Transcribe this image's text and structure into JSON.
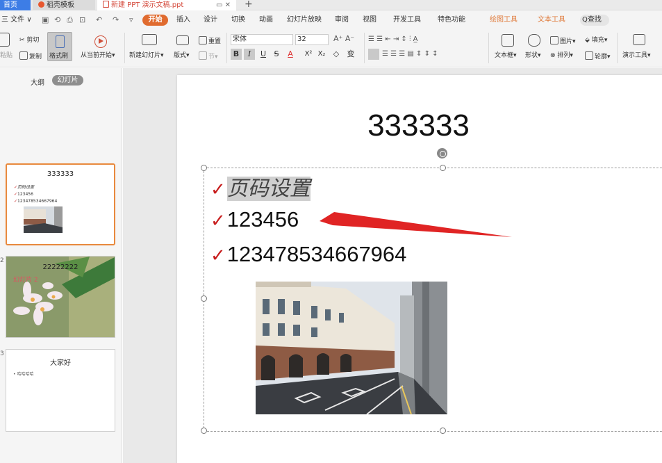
{
  "tabs": {
    "home": "首页",
    "template": "稻壳模板",
    "document": "新建 PPT 演示文稿.ppt",
    "add": "+"
  },
  "menu": {
    "file": "三 文件 ∨",
    "tabs": [
      "开始",
      "插入",
      "设计",
      "切换",
      "动画",
      "幻灯片放映",
      "审阅",
      "视图",
      "开发工具",
      "特色功能",
      "绘图工具",
      "文本工具"
    ],
    "search": "Q查找"
  },
  "ribbon": {
    "paste": "粘贴",
    "cut": "剪切",
    "copy": "复制",
    "format_painter": "格式刷",
    "play_from_current": "从当前开始",
    "new_slide": "新建幻灯片",
    "layout": "版式",
    "reset": "重置",
    "section": "节",
    "font_name": "宋体",
    "font_size": "32",
    "bold": "B",
    "italic": "I",
    "underline": "U",
    "strike": "S",
    "font_color": "A",
    "superscript": "X²",
    "subscript": "X₂",
    "textbox": "文本框",
    "shape": "形状",
    "picture": "图片",
    "arrange": "排列",
    "fill": "填充",
    "outline": "轮廓",
    "presentation_tools": "演示工具"
  },
  "panel": {
    "outline_tab": "大纲",
    "slides_tab": "幻灯片",
    "thumbs": [
      {
        "num": "",
        "title": "333333",
        "lines": [
          "页码设置",
          "123456",
          "123478534667964"
        ]
      },
      {
        "num": "2",
        "title": "22222222",
        "overlay": "幻灯片 2"
      },
      {
        "num": "3",
        "title": "大家好",
        "lines": [
          "哈哈哈哈"
        ]
      }
    ]
  },
  "slide": {
    "title": "333333",
    "bullets": [
      "页码设置",
      "123456",
      "123478534667964"
    ],
    "bullet_glyph": "✓"
  },
  "colors": {
    "accent_orange": "#e06b2f",
    "home_tab_blue": "#3d7de6",
    "check_red": "#c81e1e",
    "arrow_red": "#e02424"
  }
}
